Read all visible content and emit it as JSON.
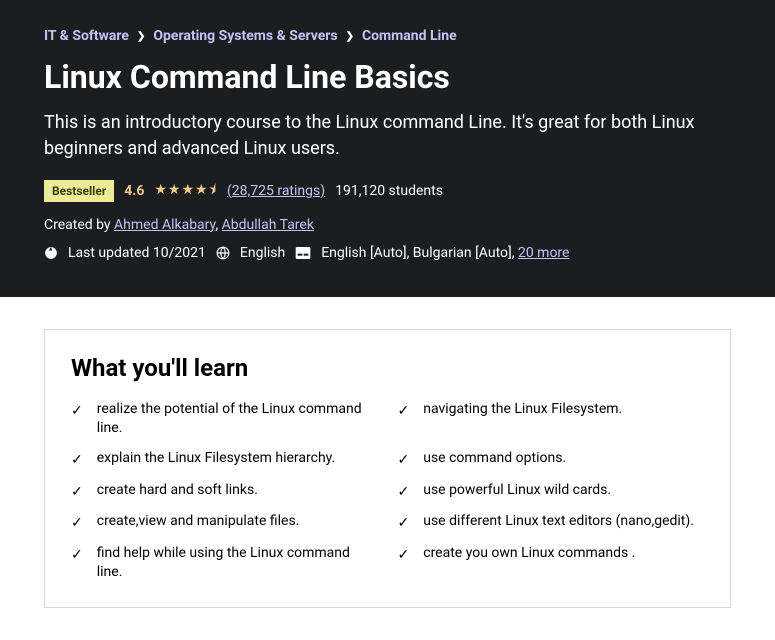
{
  "breadcrumb": {
    "items": [
      "IT & Software",
      "Operating Systems & Servers",
      "Command Line"
    ]
  },
  "title": "Linux Command Line Basics",
  "subtitle": "This is an introductory course to the Linux command Line. It's great for both Linux beginners and advanced Linux users.",
  "badge": "Bestseller",
  "rating": "4.6",
  "ratings_count": "(28,725 ratings)",
  "students": "191,120 students",
  "created_prefix": "Created by ",
  "authors": [
    "Ahmed Alkabary",
    "Abdullah Tarek"
  ],
  "last_updated": "Last updated 10/2021",
  "language": "English",
  "captions": "English [Auto], Bulgarian [Auto], ",
  "captions_more": "20 more",
  "learn_title": "What you'll learn",
  "learn_items": [
    "realize the potential of the Linux command line.",
    "navigating the Linux Filesystem.",
    "explain the Linux Filesystem hierarchy.",
    "use command options.",
    "create hard and soft links.",
    "use powerful Linux wild cards.",
    "create,view and manipulate files.",
    "use different Linux text editors (nano,gedit).",
    "find help while using the Linux command line.",
    "create you own Linux commands ."
  ]
}
